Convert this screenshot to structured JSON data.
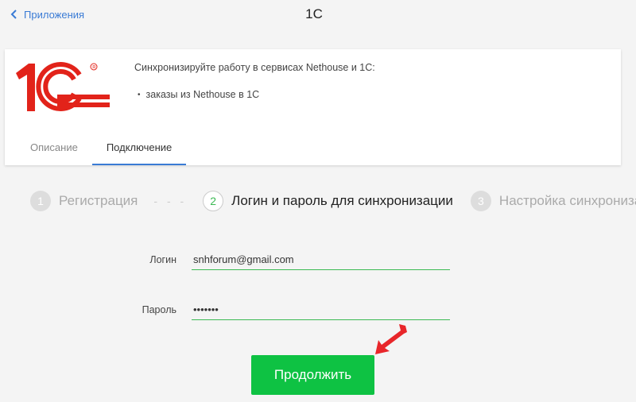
{
  "header": {
    "back_label": "Приложения",
    "title": "1С"
  },
  "card": {
    "logo_text": "1С",
    "description": "Синхронизируйте работу в сервисах Nethouse и 1С:",
    "features": [
      "заказы из Nethouse в 1С"
    ],
    "tabs": [
      {
        "label": "Описание",
        "active": false
      },
      {
        "label": "Подключение",
        "active": true
      }
    ]
  },
  "steps": [
    {
      "number": "1",
      "label": "Регистрация",
      "state": "inactive"
    },
    {
      "number": "2",
      "label": "Логин и пароль для синхронизации",
      "state": "current"
    },
    {
      "number": "3",
      "label": "Настройка синхронизации",
      "state": "inactive"
    }
  ],
  "form": {
    "login_label": "Логин",
    "login_value": "snhforum@gmail.com",
    "password_label": "Пароль",
    "password_value": "•••••••",
    "submit_label": "Продолжить"
  },
  "colors": {
    "accent_blue": "#3a7bd5",
    "accent_green": "#0ec243",
    "logo_red": "#e2231a",
    "annotation_arrow": "#e8262a"
  },
  "icons": {
    "back": "chevron-left-icon",
    "annotation": "red-arrow-icon"
  }
}
